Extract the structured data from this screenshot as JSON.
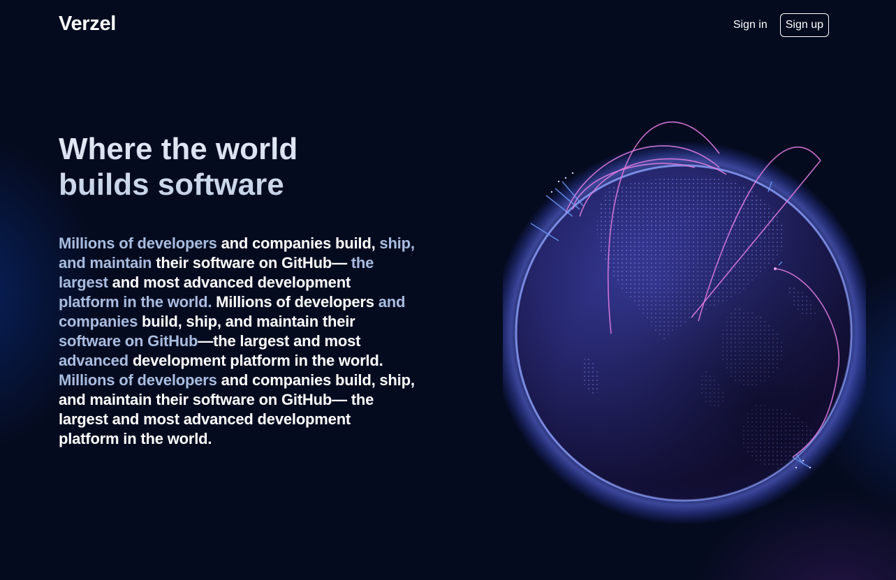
{
  "header": {
    "logo": "Verzel",
    "sign_in_label": "Sign in",
    "sign_up_label": "Sign up"
  },
  "hero": {
    "headline_line1": "Where the world",
    "headline_line2": "builds software",
    "paragraph_segments": [
      {
        "text": "Millions of developers",
        "dim": true
      },
      {
        "text": " and companies build,",
        "dim": false
      },
      {
        "text": " ship, and maintain",
        "dim": true
      },
      {
        "text": " their software on GitHub—",
        "dim": false
      },
      {
        "text": " the largest",
        "dim": true
      },
      {
        "text": " and most advanced development",
        "dim": false
      },
      {
        "text": " platform in the world.",
        "dim": true
      },
      {
        "text": " Millions of developers",
        "dim": false
      },
      {
        "text": " and companies",
        "dim": true
      },
      {
        "text": " build, ship, and maintain their",
        "dim": false
      },
      {
        "text": " software on GitHub",
        "dim": true
      },
      {
        "text": "—the largest and most",
        "dim": false
      },
      {
        "text": " advanced",
        "dim": true
      },
      {
        "text": " development platform in the world.",
        "dim": false
      },
      {
        "text": " Millions of developers",
        "dim": true
      },
      {
        "text": " and companies build, ship, and maintain their software on GitHub— the largest and most advanced development platform in the world.",
        "dim": false
      }
    ]
  },
  "colors": {
    "background": "#050b1f",
    "globe_glow": "#5b6cff",
    "arc": "#e07be0"
  },
  "icons": {
    "globe": "globe-illustration"
  }
}
